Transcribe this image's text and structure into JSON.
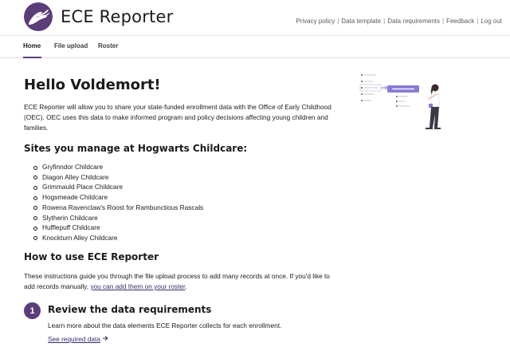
{
  "header": {
    "app_title": "ECE Reporter",
    "utility_links": [
      "Privacy policy",
      "Data template",
      "Data requirements",
      "Feedback",
      "Log out"
    ]
  },
  "tabs": [
    {
      "label": "Home",
      "active": true
    },
    {
      "label": "File upload",
      "active": false
    },
    {
      "label": "Roster",
      "active": false
    }
  ],
  "main": {
    "greeting": "Hello Voldemort!",
    "intro": "ECE Reporter will allow you to share your state-funded enrollment data with the Office of Early Childhood (OEC). OEC uses this data to make informed program and policy decisions affecting young children and families.",
    "sites_heading": "Sites you manage at Hogwarts Childcare:",
    "sites": [
      "Gryfinndor Childcare",
      "Diagon Alley Childcare",
      "Grimmauld Place Childcare",
      "Hogsmeade Childcare",
      "Rowena Ravenclaw's Roost for Rambunctious Rascals",
      "Slytherin Childcare",
      "Hufflepuff Childcare",
      "Knockturn Alley Childcare"
    ],
    "howto_heading": "How to use ECE Reporter",
    "howto_text": "These instructions guide you through the file upload process to add many records at once. If you'd like to add records manually, ",
    "howto_link": "you can add them on your roster",
    "howto_end": ".",
    "step": {
      "number": "1",
      "title": "Review the data requirements",
      "description": "Learn more about the data elements ECE Reporter collects for each enrollment.",
      "link": "See required data"
    }
  },
  "colors": {
    "brand": "#5b3d7a",
    "link": "#3c2a70",
    "illustration_accent": "#8c7bd4"
  },
  "icons": {
    "logo": "hands-logo",
    "step_link_arrow": "arrow-right-icon"
  }
}
